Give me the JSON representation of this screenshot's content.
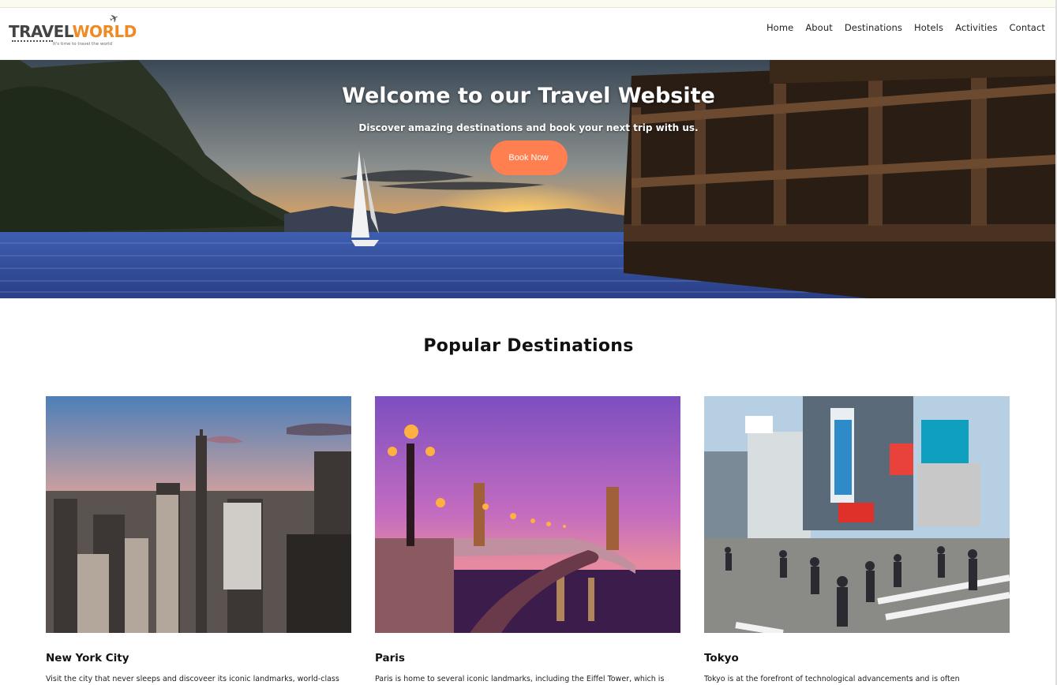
{
  "logo": {
    "part1": "TRAVEL",
    "part2": "WORLD",
    "tagline": "It's time to travel the world",
    "icon": "plane-icon"
  },
  "nav": {
    "items": [
      "Home",
      "About",
      "Destinations",
      "Hotels",
      "Activities",
      "Contact"
    ]
  },
  "hero": {
    "title": "Welcome to our Travel Website",
    "subtitle": "Discover amazing destinations and book your next trip with us.",
    "cta": "Book Now",
    "cta_color": "#ff7f50"
  },
  "destinations": {
    "heading": "Popular Destinations",
    "cards": [
      {
        "name": "New York City",
        "text": "Visit the city that never sleeps and discoveer its iconic landmarks, world-class"
      },
      {
        "name": "Paris",
        "text": "Paris is home to several iconic landmarks, including the Eiffel Tower, which is"
      },
      {
        "name": "Tokyo",
        "text": "Tokyo is at the forefront of technological advancements and is often"
      }
    ]
  },
  "colors": {
    "accent": "#f08a24",
    "button": "#ff7f50"
  }
}
